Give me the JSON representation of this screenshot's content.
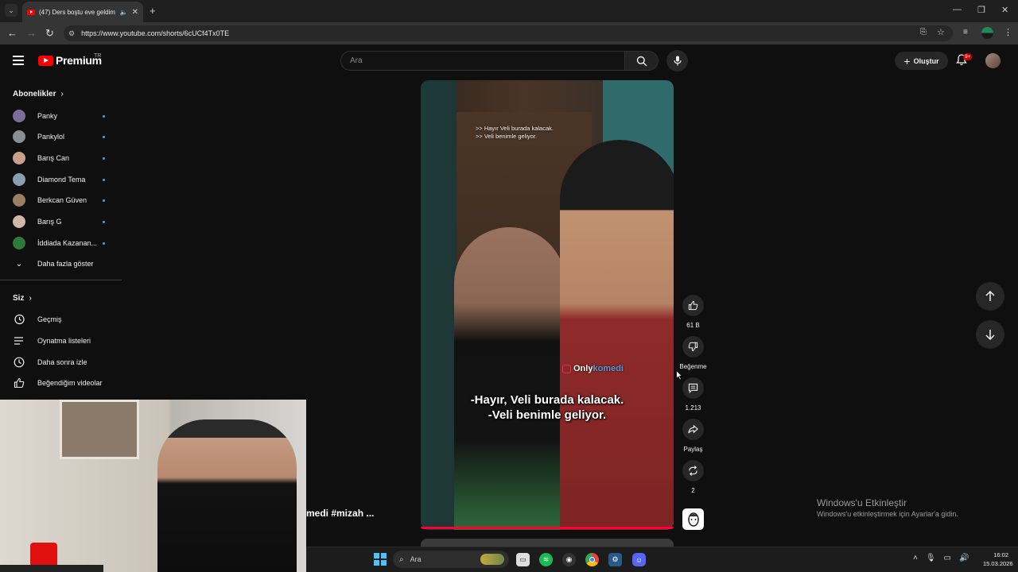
{
  "browser": {
    "tab_title": "(47) Ders boştu eve geldim",
    "url": "https://www.youtube.com/shorts/6cUCf4Tx0TE"
  },
  "header": {
    "logo_text": "Premium",
    "region": "TR",
    "search_placeholder": "Ara",
    "create_label": "Oluştur",
    "notification_badge": "9+"
  },
  "sidebar": {
    "subscriptions_heading": "Abonelikler",
    "channels": [
      {
        "name": "Panky",
        "color": "#7a6f9a"
      },
      {
        "name": "Pankylol",
        "color": "#8a8f95"
      },
      {
        "name": "Barış Can",
        "color": "#c9a08a"
      },
      {
        "name": "Diamond Tema",
        "color": "#8aa0b0"
      },
      {
        "name": "Berkcan Güven",
        "color": "#9a8060"
      },
      {
        "name": "Barış G",
        "color": "#d0b8a8"
      },
      {
        "name": "İddiada Kazanan...",
        "color": "#2f7a3a"
      }
    ],
    "show_more": "Daha fazla göster",
    "you_heading": "Siz",
    "you_items": [
      {
        "label": "Geçmiş",
        "icon": "history-icon"
      },
      {
        "label": "Oynatma listeleri",
        "icon": "playlist-icon"
      },
      {
        "label": "Daha sonra izle",
        "icon": "clock-icon"
      },
      {
        "label": "Beğendiğim videolar",
        "icon": "thumbs-up-icon"
      }
    ]
  },
  "short": {
    "subtitle_small_1": ">> Hayır Veli burada kalacak.",
    "subtitle_small_2": ">> Veli benimle geliyor.",
    "watermark_main": "Only",
    "watermark_accent": "komedi",
    "subtitle_big_1": "-Hayır, Veli burada kalacak.",
    "subtitle_big_2": "-Veli benimle geliyor.",
    "title_overlay": "medi #mizah ..."
  },
  "actions": {
    "likes": "61 B",
    "dislike_label": "Beğenme",
    "comments": "1.213",
    "share_label": "Paylaş",
    "remix": "2"
  },
  "windows": {
    "activate_title": "Windows'u Etkinleştir",
    "activate_sub": "Windows'u etkinleştirmek için Ayarlar'a gidin.",
    "search_label": "Ara",
    "time": "16:02",
    "date": "15.03.2026"
  }
}
